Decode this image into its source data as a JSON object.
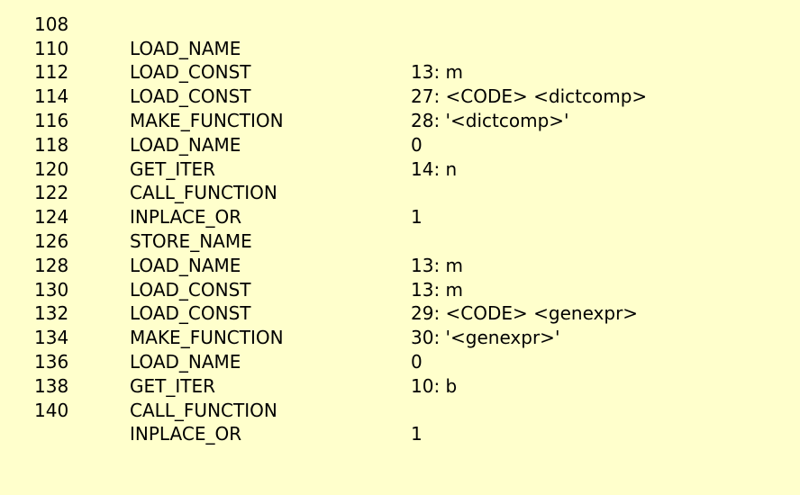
{
  "bytecode": {
    "instructions": [
      {
        "offset": "108",
        "opname": "LOAD_NAME",
        "arg": "13: m"
      },
      {
        "offset": "110",
        "opname": "LOAD_CONST",
        "arg": "27: <CODE> <dictcomp>"
      },
      {
        "offset": "112",
        "opname": "LOAD_CONST",
        "arg": "28: '<dictcomp>'"
      },
      {
        "offset": "114",
        "opname": "MAKE_FUNCTION",
        "arg": "0"
      },
      {
        "offset": "116",
        "opname": "LOAD_NAME",
        "arg": "14: n"
      },
      {
        "offset": "118",
        "opname": "GET_ITER",
        "arg": ""
      },
      {
        "offset": "120",
        "opname": "CALL_FUNCTION",
        "arg": "1"
      },
      {
        "offset": "122",
        "opname": "INPLACE_OR",
        "arg": ""
      },
      {
        "offset": "124",
        "opname": "STORE_NAME",
        "arg": "13: m"
      },
      {
        "offset": "126",
        "opname": "LOAD_NAME",
        "arg": "13: m"
      },
      {
        "offset": "128",
        "opname": "LOAD_CONST",
        "arg": "29: <CODE> <genexpr>"
      },
      {
        "offset": "130",
        "opname": "LOAD_CONST",
        "arg": "30: '<genexpr>'"
      },
      {
        "offset": "132",
        "opname": "MAKE_FUNCTION",
        "arg": "0"
      },
      {
        "offset": "134",
        "opname": "LOAD_NAME",
        "arg": "10: b"
      },
      {
        "offset": "136",
        "opname": "GET_ITER",
        "arg": ""
      },
      {
        "offset": "138",
        "opname": "CALL_FUNCTION",
        "arg": "1"
      },
      {
        "offset": "140",
        "opname": "INPLACE_OR",
        "arg": ""
      }
    ]
  }
}
